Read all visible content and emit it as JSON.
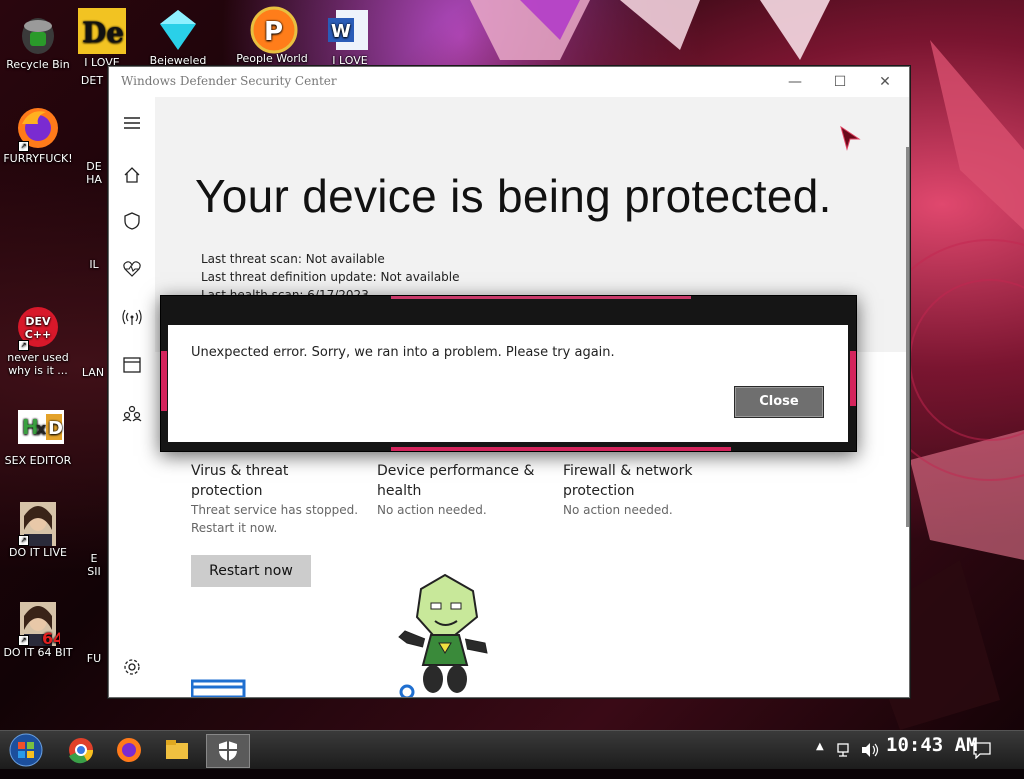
{
  "desktop": {
    "icons": [
      {
        "label": "Recycle Bin"
      },
      {
        "label": "FURRYFUCK!"
      },
      {
        "label": "never used why is it ..."
      },
      {
        "label": "SEX EDITOR"
      },
      {
        "label": "DO IT LIVE"
      },
      {
        "label": "DO IT 64 BIT"
      },
      {
        "label": "LAN"
      },
      {
        "label": "FU"
      }
    ],
    "top_icon_labels": [
      "I LOVE",
      "Bejeweled",
      "People World of",
      "I LOVE"
    ],
    "partial_labels": [
      "DET",
      "DE",
      "HA",
      "IL",
      "E",
      "SII"
    ]
  },
  "window": {
    "title": "Windows Defender Security Center",
    "controls": {
      "minimize": "—",
      "maximize": "☐",
      "close": "✕"
    },
    "headline": "Your device is being protected.",
    "status": [
      {
        "label": "Last threat scan:",
        "value": "Not available"
      },
      {
        "label": "Last threat definition update:",
        "value": "Not available"
      },
      {
        "label": "Last health scan:",
        "value": "6/17/2023"
      }
    ],
    "cards": [
      {
        "title": "Virus & threat protection",
        "subtitle": "Threat service has stopped. Restart it now."
      },
      {
        "title": "Device performance & health",
        "subtitle": "No action needed."
      },
      {
        "title": "Firewall & network protection",
        "subtitle": "No action needed."
      }
    ],
    "restart_button": "Restart now"
  },
  "dialog": {
    "message": "Unexpected error. Sorry, we ran into a problem.  Please try again.",
    "close_label": "Close"
  },
  "taskbar": {
    "clock": "10:43 AM"
  },
  "colors": {
    "accent_pink": "#d4245c",
    "dialog_button": "#6f6f6f"
  }
}
